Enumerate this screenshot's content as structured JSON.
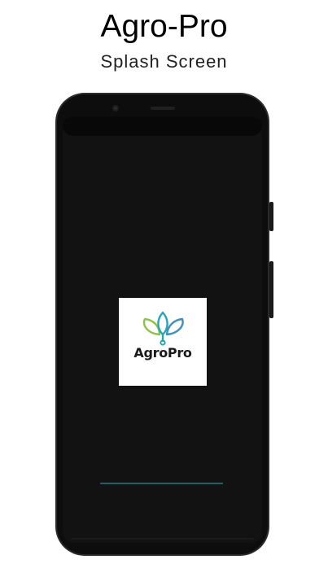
{
  "header": {
    "title": "Agro-Pro",
    "subtitle": "Splash Screen"
  },
  "splash": {
    "brand_name": "AgroPro",
    "logo_icon": "sprout-leaves-icon",
    "progress_color": "#1f5f66"
  },
  "colors": {
    "screen_background": "#121212",
    "phone_frame": "#2b2b2b",
    "leaf_green": "#8bc34a",
    "leaf_teal": "#26a6b6",
    "leaf_blue": "#3f8fc2"
  }
}
